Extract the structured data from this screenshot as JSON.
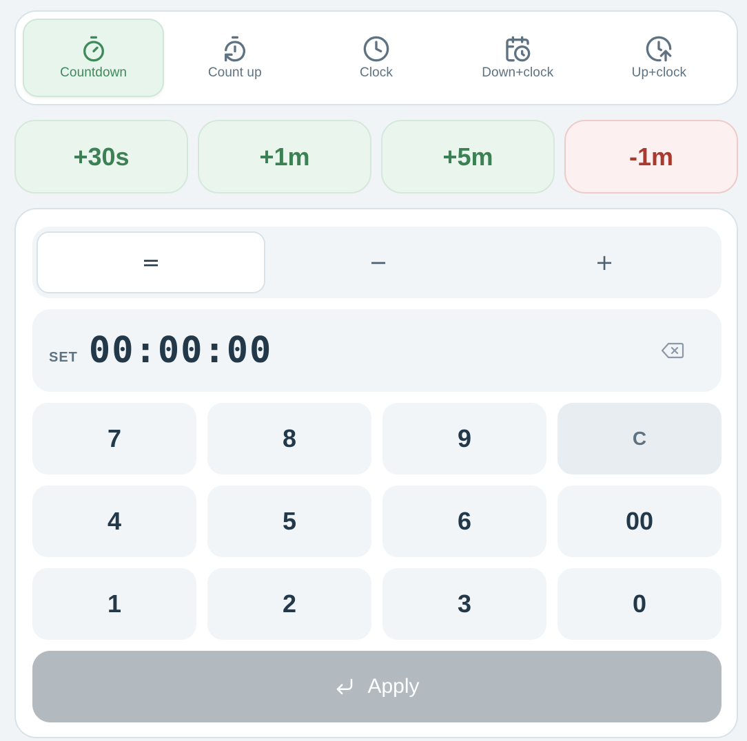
{
  "modes": [
    {
      "label": "Countdown",
      "icon": "stopwatch-icon",
      "active": true
    },
    {
      "label": "Count up",
      "icon": "timer-reset-icon",
      "active": false
    },
    {
      "label": "Clock",
      "icon": "clock-icon",
      "active": false
    },
    {
      "label": "Down+clock",
      "icon": "calendar-clock-icon",
      "active": false
    },
    {
      "label": "Up+clock",
      "icon": "clock-arrow-up-icon",
      "active": false
    }
  ],
  "quick": [
    "+30s",
    "+1m",
    "+5m",
    "-1m"
  ],
  "ops": [
    "=",
    "−",
    "+"
  ],
  "display": {
    "set_label": "SET",
    "time": "00:00:00"
  },
  "keys": {
    "r1": [
      "7",
      "8",
      "9",
      "C"
    ],
    "r2": [
      "4",
      "5",
      "6",
      "00"
    ],
    "r3": [
      "1",
      "2",
      "3",
      "0"
    ]
  },
  "apply_label": "Apply",
  "colors": {
    "accent_green": "#3f8a5b",
    "accent_red": "#a83a2e",
    "apply_disabled": "#b3babf"
  }
}
